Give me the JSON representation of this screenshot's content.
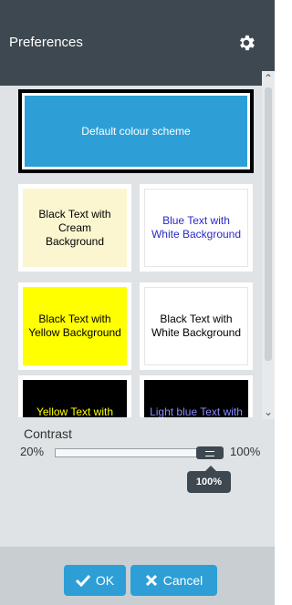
{
  "header": {
    "title": "Preferences",
    "gear_icon": "gear-icon"
  },
  "schemes": {
    "default": {
      "label": "Default colour scheme",
      "bg": "#2d9fd6",
      "fg": "#ffffff"
    },
    "items": [
      {
        "label": "Black Text with Cream Background",
        "fg": "#000000",
        "bg": "#fbf6cf"
      },
      {
        "label": "Blue Text with White Background",
        "fg": "#2a2ac8",
        "bg": "#ffffff"
      },
      {
        "label": "Black Text with Yellow Background",
        "fg": "#000000",
        "bg": "#ffff00"
      },
      {
        "label": "Black Text with White Background",
        "fg": "#000000",
        "bg": "#ffffff"
      },
      {
        "label": "Yellow Text with Black Background",
        "fg": "#ffff00",
        "bg": "#000000"
      },
      {
        "label": "Light blue Text with Black Background",
        "fg": "#8a8aff",
        "bg": "#000000"
      }
    ]
  },
  "contrast": {
    "label": "Contrast",
    "min_label": "20%",
    "max_label": "100%",
    "value_label": "100%",
    "value": 100
  },
  "footer": {
    "ok_label": "OK",
    "cancel_label": "Cancel"
  },
  "colors": {
    "accent": "#2d9fd6",
    "header": "#3d4850"
  }
}
